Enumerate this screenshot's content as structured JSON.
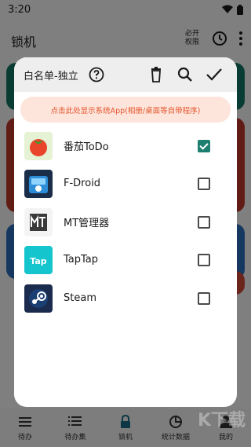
{
  "status_bar": {
    "time": "3:20"
  },
  "app_bar": {
    "title": "锁机",
    "permission_line1": "必开",
    "permission_line2": "权限"
  },
  "bottom_nav": [
    {
      "label": "待办",
      "icon": "list-icon"
    },
    {
      "label": "待办集",
      "icon": "list-collection-icon"
    },
    {
      "label": "锁机",
      "icon": "lock-icon"
    },
    {
      "label": "统计数据",
      "icon": "pie-chart-icon"
    },
    {
      "label": "我的",
      "icon": "person-icon"
    }
  ],
  "dialog": {
    "title": "白名单-独立",
    "banner": "点击此处显示系统App(相册/桌面等自带程序)",
    "accent_color": "#1c7f6f",
    "apps": [
      {
        "name": "番茄ToDo",
        "checked": true,
        "icon": "tomato-icon"
      },
      {
        "name": "F-Droid",
        "checked": false,
        "icon": "fdroid-icon"
      },
      {
        "name": "MT管理器",
        "checked": false,
        "icon": "mt-manager-icon"
      },
      {
        "name": "TapTap",
        "checked": false,
        "icon": "taptap-icon"
      },
      {
        "name": "Steam",
        "checked": false,
        "icon": "steam-icon"
      }
    ]
  },
  "watermark": "K下载"
}
